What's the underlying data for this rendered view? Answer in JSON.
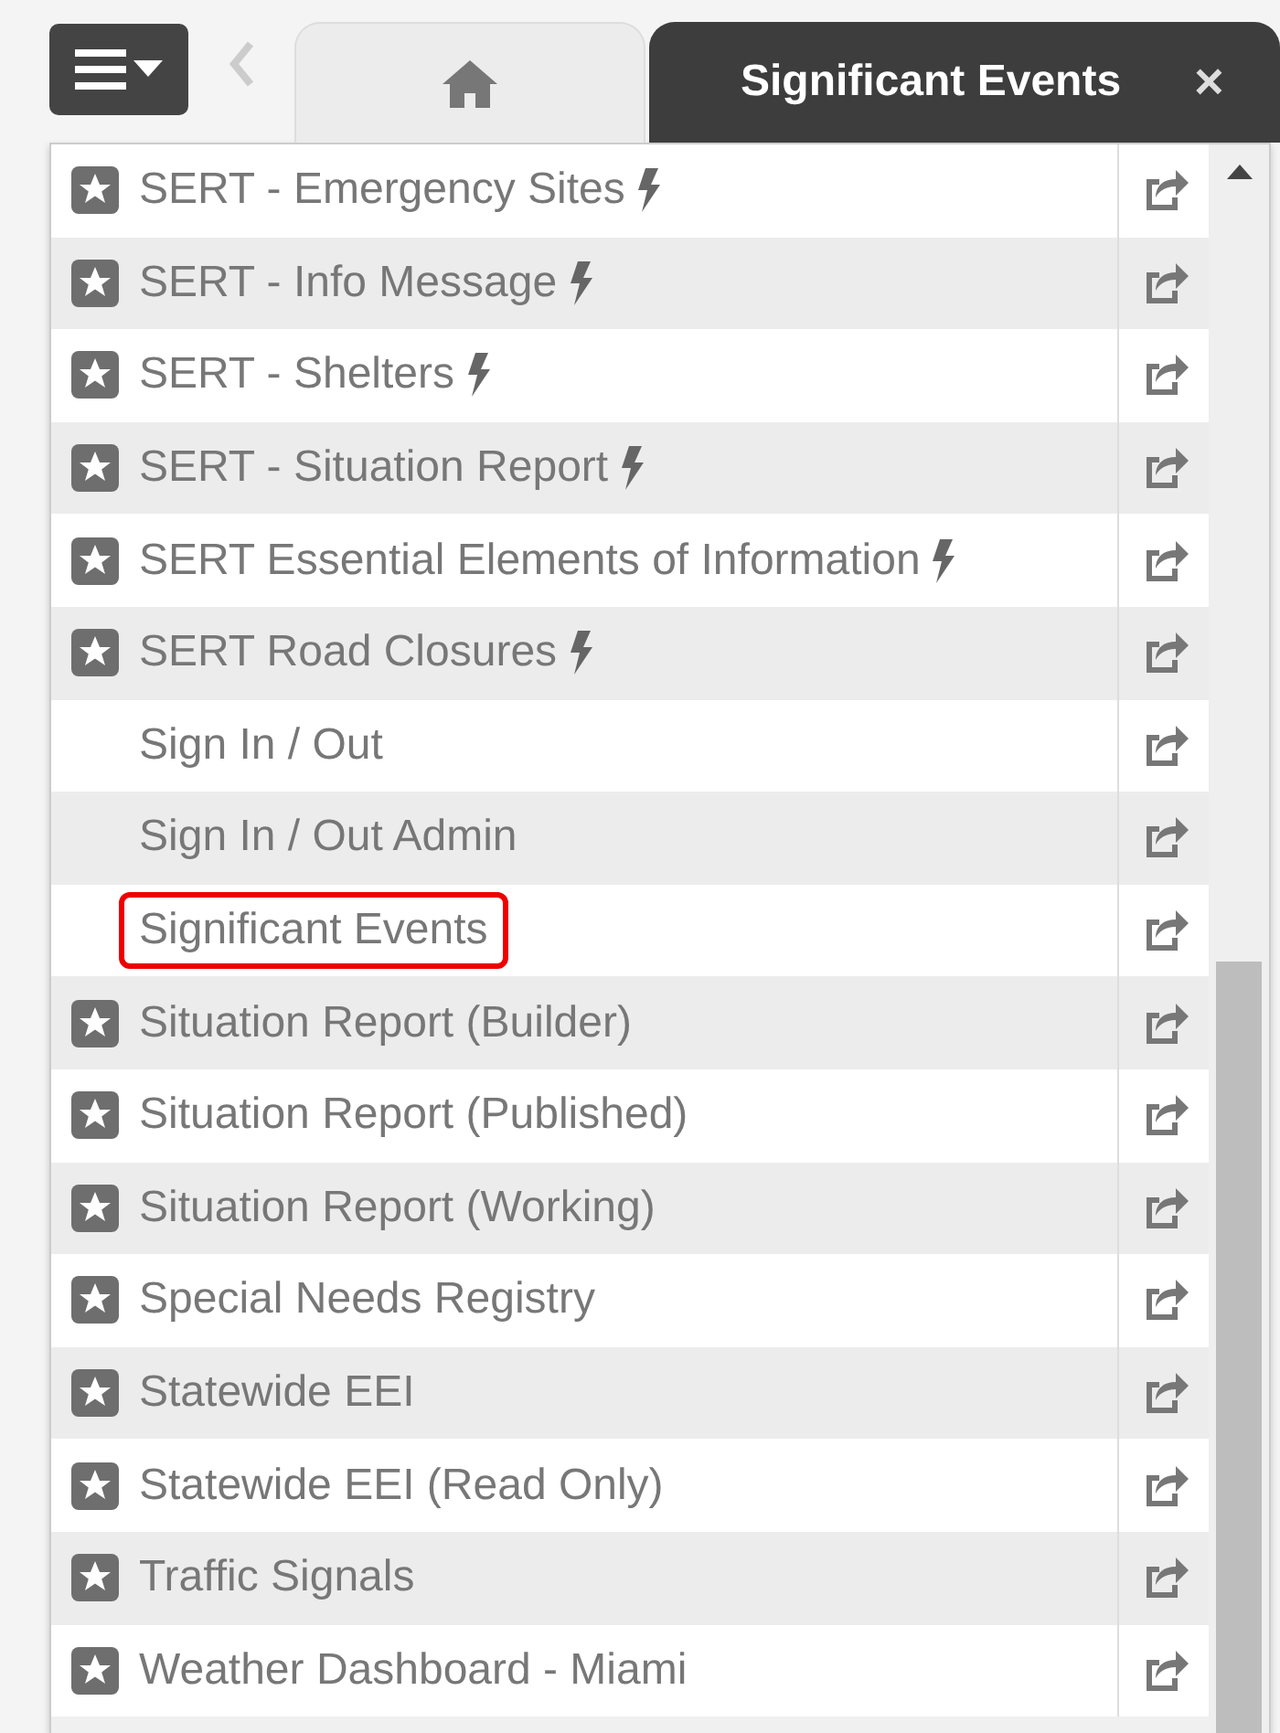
{
  "tabs": [
    {
      "kind": "home",
      "selected": false
    },
    {
      "kind": "page",
      "label": "Significant Events",
      "close": "×",
      "selected": true
    }
  ],
  "menu": {
    "items": [
      {
        "label": "SERT - Emergency Sites",
        "starred": true,
        "lightning": true,
        "selected": false
      },
      {
        "label": "SERT - Info Message",
        "starred": true,
        "lightning": true,
        "selected": false
      },
      {
        "label": "SERT - Shelters",
        "starred": true,
        "lightning": true,
        "selected": false
      },
      {
        "label": "SERT - Situation Report",
        "starred": true,
        "lightning": true,
        "selected": false
      },
      {
        "label": "SERT Essential Elements of Information",
        "starred": true,
        "lightning": true,
        "selected": false
      },
      {
        "label": "SERT Road Closures",
        "starred": true,
        "lightning": true,
        "selected": false
      },
      {
        "label": "Sign In / Out",
        "starred": false,
        "lightning": false,
        "selected": false
      },
      {
        "label": "Sign In / Out Admin",
        "starred": false,
        "lightning": false,
        "selected": false
      },
      {
        "label": "Significant Events",
        "starred": false,
        "lightning": false,
        "selected": true
      },
      {
        "label": "Situation Report (Builder)",
        "starred": true,
        "lightning": false,
        "selected": false
      },
      {
        "label": "Situation Report (Published)",
        "starred": true,
        "lightning": false,
        "selected": false
      },
      {
        "label": "Situation Report (Working)",
        "starred": true,
        "lightning": false,
        "selected": false
      },
      {
        "label": "Special Needs Registry",
        "starred": true,
        "lightning": false,
        "selected": false
      },
      {
        "label": "Statewide EEI",
        "starred": true,
        "lightning": false,
        "selected": false
      },
      {
        "label": "Statewide EEI (Read Only)",
        "starred": true,
        "lightning": false,
        "selected": false
      },
      {
        "label": "Traffic Signals",
        "starred": true,
        "lightning": false,
        "selected": false
      },
      {
        "label": "Weather Dashboard - Miami",
        "starred": true,
        "lightning": false,
        "selected": false
      }
    ]
  }
}
